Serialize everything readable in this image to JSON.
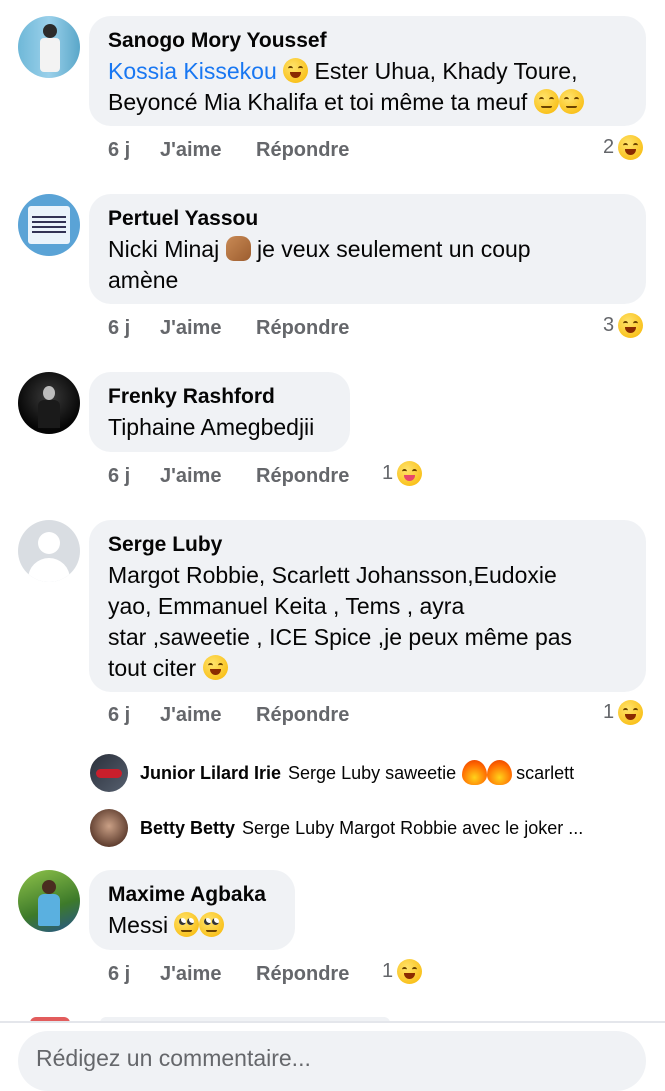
{
  "comments": [
    {
      "author": "Sanogo Mory Youssef",
      "mention": "Kossia Kissekou",
      "text_line1": "Ester Uhua, Khady Toure,",
      "text_line2": "Beyoncé Mia Khalifa et toi même ta meuf",
      "time": "6 j",
      "like": "J'aime",
      "reply": "Répondre",
      "reaction_count": "2",
      "reaction_icon": "laughing-emoji"
    },
    {
      "author": "Pertuel Yassou",
      "text_line1a": "Nicki Minaj",
      "text_line1b": "je veux seulement un coup",
      "text_line2": "amène",
      "time": "6 j",
      "like": "J'aime",
      "reply": "Répondre",
      "reaction_count": "3",
      "reaction_icon": "laughing-emoji"
    },
    {
      "author": "Frenky Rashford",
      "text_line1": "Tiphaine Amegbedjii",
      "time": "6 j",
      "like": "J'aime",
      "reply": "Répondre",
      "reaction_count": "1",
      "reaction_icon": "tongue-emoji"
    },
    {
      "author": "Serge Luby",
      "text_line1": "Margot Robbie, Scarlett Johansson,Eudoxie",
      "text_line2": "yao, Emmanuel Keita , Tems , ayra",
      "text_line3": "star ,saweetie , ICE Spice ,je peux même pas",
      "text_line4": "tout citer",
      "time": "6 j",
      "like": "J'aime",
      "reply": "Répondre",
      "reaction_count": "1",
      "reaction_icon": "laughing-emoji",
      "replies": [
        {
          "author": "Junior Lilard Irie",
          "text_a": "Serge Luby saweetie",
          "text_b": "scarlett"
        },
        {
          "author": "Betty Betty",
          "text_a": "Serge Luby Margot Robbie avec le joker ..."
        }
      ]
    },
    {
      "author": "Maxime Agbaka",
      "text_line1": "Messi",
      "time": "6 j",
      "like": "J'aime",
      "reply": "Répondre",
      "reaction_count": "1",
      "reaction_icon": "laughing-emoji"
    }
  ],
  "composer": {
    "placeholder": "Rédigez un commentaire..."
  },
  "colors": {
    "bubble": "#f0f2f5",
    "mention": "#1877f2",
    "secondary_text": "#65676b"
  }
}
